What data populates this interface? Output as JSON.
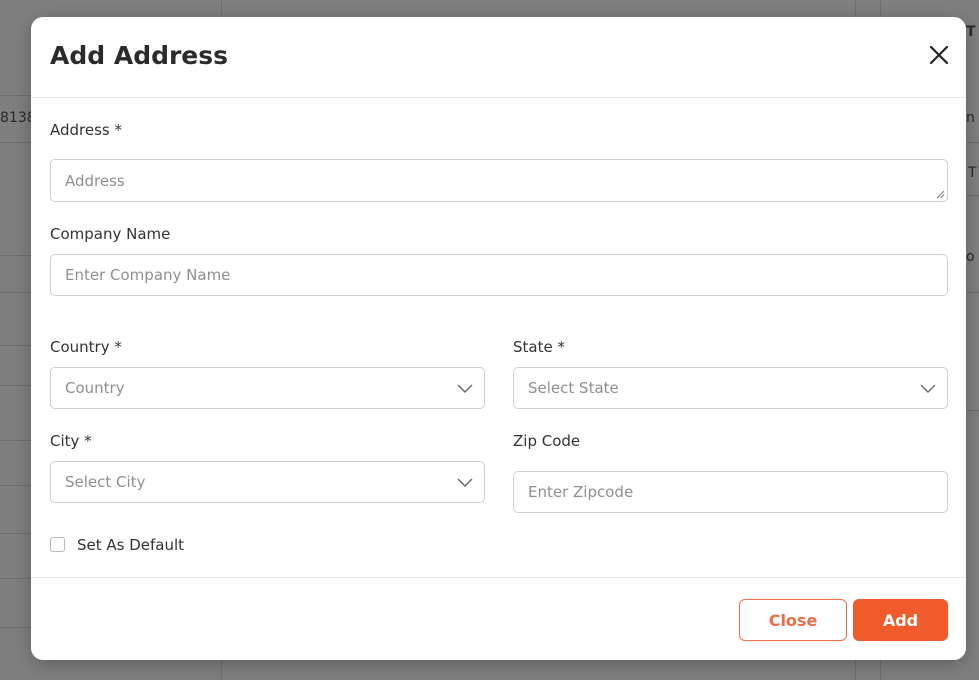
{
  "background": {
    "fragments": {
      "order_id": "8138",
      "col_a": "T",
      "col_b": "n",
      "col_c": "T",
      "col_d": "o"
    }
  },
  "modal": {
    "title": "Add Address",
    "close_icon": "close-icon",
    "address": {
      "label": "Address *",
      "placeholder": "Address"
    },
    "company": {
      "label": "Company Name",
      "placeholder": "Enter Company Name"
    },
    "country": {
      "label": "Country *",
      "value": "Country"
    },
    "state": {
      "label": "State *",
      "value": "Select State"
    },
    "city": {
      "label": "City *",
      "value": "Select City"
    },
    "zip": {
      "label": "Zip Code",
      "placeholder": "Enter Zipcode"
    },
    "default_checkbox": {
      "label": "Set As Default",
      "checked": false
    },
    "buttons": {
      "close": "Close",
      "add": "Add"
    }
  },
  "colors": {
    "accent": "#f15a2a",
    "accent_outline": "#f26b45"
  }
}
